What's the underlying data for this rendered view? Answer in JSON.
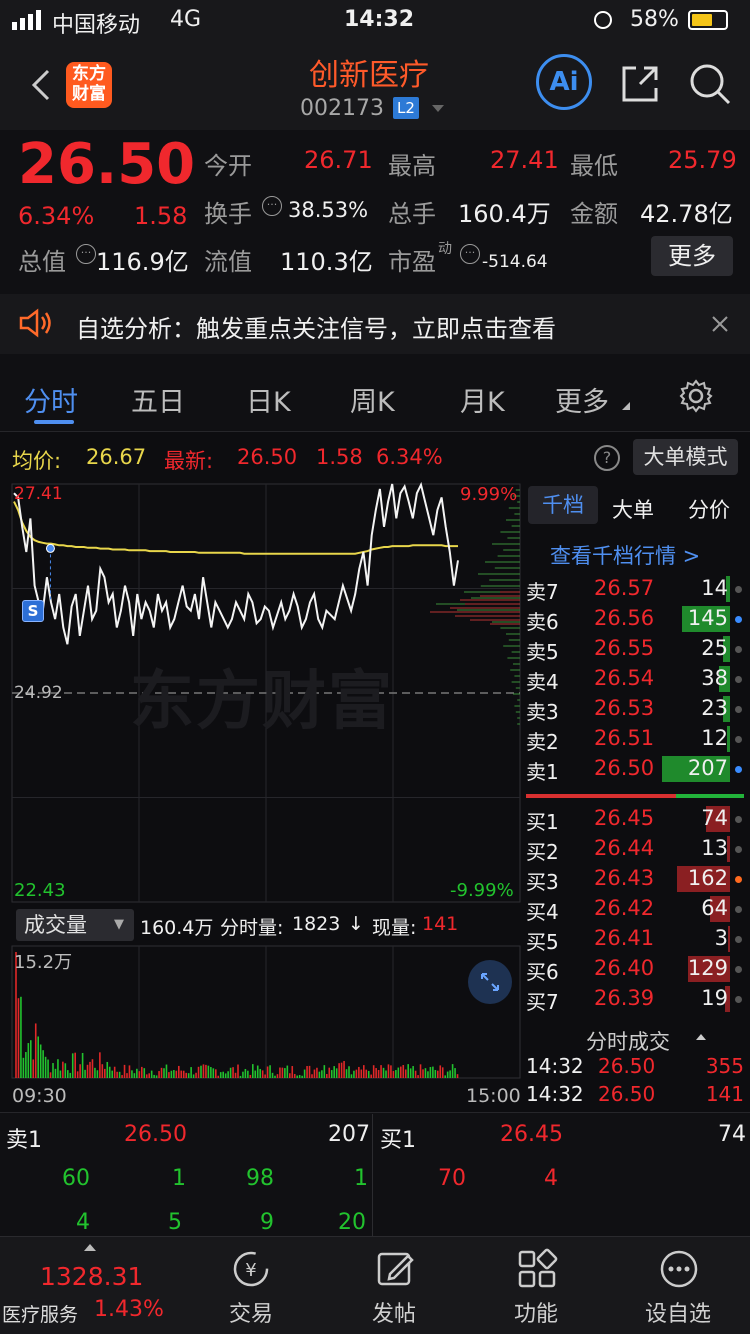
{
  "status_bar": {
    "carrier": "中国移动",
    "network": "4G",
    "time": "14:32",
    "battery": "58%"
  },
  "header": {
    "logo_line1": "东方",
    "logo_line2": "财富",
    "stock_name": "创新医疗",
    "stock_code": "002173",
    "level_badge": "L2",
    "ai_label": "Ai"
  },
  "quote": {
    "price": "26.50",
    "change_pct": "6.34%",
    "change": "1.58",
    "open_label": "今开",
    "open": "26.71",
    "high_label": "最高",
    "high": "27.41",
    "low_label": "最低",
    "low": "25.79",
    "turnover_label": "换手",
    "turnover": "38.53%",
    "volume_label": "总手",
    "volume": "160.4万",
    "amount_label": "金额",
    "amount": "42.78亿",
    "mktcap_label": "总值",
    "mktcap": "116.9亿",
    "float_label": "流值",
    "float": "110.3亿",
    "pe_label": "市盈",
    "pe_sup": "动",
    "pe": "-514.64",
    "more_label": "更多"
  },
  "notice": {
    "text": "自选分析：触发重点关注信号，立即点击查看"
  },
  "tabs": [
    "分时",
    "五日",
    "日K",
    "周K",
    "月K",
    "更多"
  ],
  "chart_info": {
    "avg_label": "均价:",
    "avg": "26.67",
    "latest_label": "最新:",
    "latest": "26.50",
    "chg": "1.58",
    "chg_pct": "6.34%",
    "mode_button": "大单模式"
  },
  "chart_data": {
    "type": "line",
    "title": "",
    "x_start": "09:30",
    "x_end": "15:00",
    "ylim": [
      22.43,
      27.41
    ],
    "prev_close": 24.92,
    "y_top_label": "27.41",
    "y_mid_label": "24.92",
    "y_bottom_label": "22.43",
    "pct_top_label": "9.99%",
    "pct_bottom_label": "-9.99%",
    "watermark": "东方财富",
    "signal_marker": "S",
    "series": [
      {
        "values": [
          27.3,
          27.25,
          26.9,
          26.6,
          27.0,
          26.2,
          26.0,
          25.9,
          26.3,
          26.0,
          25.8,
          26.1,
          25.7,
          25.5,
          25.95,
          26.1,
          25.6,
          25.9,
          26.2,
          25.8,
          25.9,
          26.4,
          26.3,
          26.0,
          26.1,
          25.7,
          25.9,
          26.2,
          26.0,
          25.6,
          26.1,
          25.8,
          26.0,
          25.9,
          25.7,
          26.1,
          25.9,
          26.0,
          25.7,
          25.8,
          26.0,
          26.2,
          25.95,
          25.9,
          26.1,
          25.8,
          26.3,
          26.0,
          25.7,
          26.0,
          25.9,
          25.8,
          25.7,
          25.8,
          26.0,
          25.9,
          25.8,
          26.1,
          26.0,
          25.75,
          25.8,
          25.95,
          25.9,
          25.7,
          25.85,
          26.0,
          25.8,
          25.9,
          26.1,
          25.95,
          25.7,
          25.8,
          26.0,
          26.1,
          25.8,
          25.7,
          25.9,
          25.85,
          25.8,
          26.0,
          26.2,
          26.05,
          25.9,
          26.1,
          26.4,
          26.6,
          26.2,
          26.8,
          27.1,
          27.35,
          26.9,
          27.2,
          27.41,
          27.0,
          27.3,
          27.38,
          27.2,
          27.0,
          27.3,
          27.4,
          27.2,
          27.0,
          26.8,
          27.1,
          27.25,
          26.9,
          26.6,
          26.2,
          26.5
        ]
      },
      {
        "values": [
          27.2,
          27.1,
          26.95,
          26.85,
          26.78,
          26.74,
          26.72,
          26.71,
          26.7,
          26.7,
          26.69,
          26.68,
          26.68,
          26.67,
          26.67,
          26.66,
          26.66,
          26.66,
          26.65,
          26.65,
          26.65,
          26.64,
          26.64,
          26.64,
          26.63,
          26.63,
          26.63,
          26.63,
          26.62,
          26.62,
          26.62,
          26.62,
          26.62,
          26.61,
          26.61,
          26.61,
          26.61,
          26.61,
          26.6,
          26.6,
          26.6,
          26.6,
          26.6,
          26.6,
          26.6,
          26.59,
          26.59,
          26.59,
          26.59,
          26.59,
          26.59,
          26.59,
          26.59,
          26.59,
          26.59,
          26.59,
          26.58,
          26.58,
          26.58,
          26.58,
          26.58,
          26.58,
          26.58,
          26.58,
          26.58,
          26.58,
          26.58,
          26.58,
          26.58,
          26.58,
          26.58,
          26.58,
          26.58,
          26.58,
          26.58,
          26.58,
          26.58,
          26.58,
          26.58,
          26.58,
          26.58,
          26.58,
          26.58,
          26.58,
          26.59,
          26.6,
          26.61,
          26.63,
          26.64,
          26.65,
          26.66,
          26.66,
          26.67,
          26.67,
          26.67,
          26.67,
          26.67,
          26.68,
          26.68,
          26.68,
          26.68,
          26.68,
          26.68,
          26.68,
          26.68,
          26.67,
          26.67,
          26.67,
          26.67
        ]
      }
    ],
    "volume": {
      "label": "成交量",
      "total": "160.4万",
      "period_label": "分时量:",
      "period": "1823",
      "current_label": "现量:",
      "current": "141",
      "max_label": "15.2万"
    }
  },
  "orderbook": {
    "tabs": [
      "千档",
      "大单",
      "分价"
    ],
    "link": "查看千档行情 >",
    "asks": [
      {
        "label": "卖7",
        "price": "26.57",
        "qty": "14",
        "bar": 0.06
      },
      {
        "label": "卖6",
        "price": "26.56",
        "qty": "145",
        "bar": 0.7
      },
      {
        "label": "卖5",
        "price": "26.55",
        "qty": "25",
        "bar": 0.1
      },
      {
        "label": "卖4",
        "price": "26.54",
        "qty": "38",
        "bar": 0.16
      },
      {
        "label": "卖3",
        "price": "26.53",
        "qty": "23",
        "bar": 0.1
      },
      {
        "label": "卖2",
        "price": "26.51",
        "qty": "12",
        "bar": 0.05
      },
      {
        "label": "卖1",
        "price": "26.50",
        "qty": "207",
        "bar": 1.0
      }
    ],
    "bids": [
      {
        "label": "买1",
        "price": "26.45",
        "qty": "74",
        "bar": 0.35
      },
      {
        "label": "买2",
        "price": "26.44",
        "qty": "13",
        "bar": 0.05
      },
      {
        "label": "买3",
        "price": "26.43",
        "qty": "162",
        "bar": 0.78
      },
      {
        "label": "买4",
        "price": "26.42",
        "qty": "64",
        "bar": 0.3
      },
      {
        "label": "买5",
        "price": "26.41",
        "qty": "3",
        "bar": 0.02
      },
      {
        "label": "买6",
        "price": "26.40",
        "qty": "129",
        "bar": 0.62
      },
      {
        "label": "买7",
        "price": "26.39",
        "qty": "19",
        "bar": 0.08
      }
    ],
    "trades_title": "分时成交",
    "trades": [
      {
        "time": "14:32",
        "price": "26.50",
        "qty": "355"
      },
      {
        "time": "14:32",
        "price": "26.50",
        "qty": "141"
      }
    ]
  },
  "queue": {
    "ask_label": "卖1",
    "ask_price": "26.50",
    "ask_total": "207",
    "bid_label": "买1",
    "bid_price": "26.45",
    "bid_total": "74",
    "ask_row1": [
      "60",
      "1",
      "98",
      "1"
    ],
    "ask_row2": [
      "4",
      "5",
      "9",
      "20"
    ],
    "bid_row1": [
      "70",
      "4"
    ]
  },
  "navbar": {
    "index_value": "1328.31",
    "index_name": "医疗服务",
    "index_pct": "1.43%",
    "items": [
      "交易",
      "发帖",
      "功能",
      "设自选"
    ]
  }
}
